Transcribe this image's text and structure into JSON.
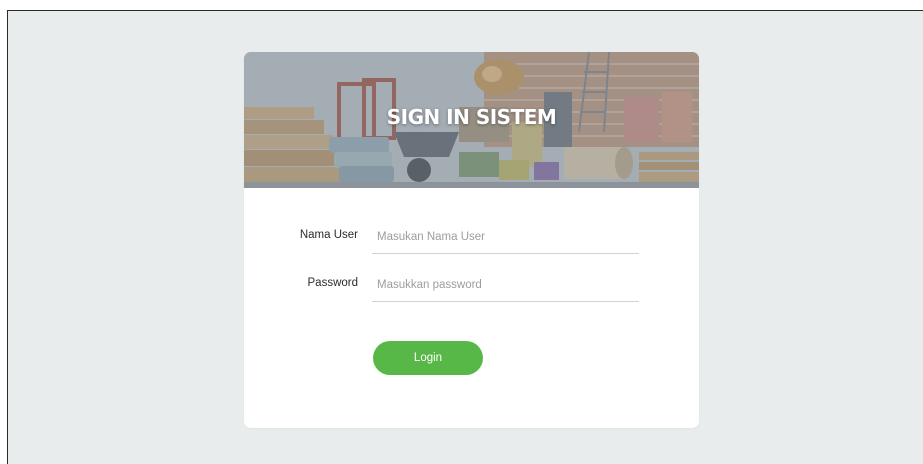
{
  "banner": {
    "title": "SIGN IN SISTEM",
    "image": "construction-materials-photo"
  },
  "form": {
    "username": {
      "label": "Nama User",
      "placeholder": "Masukan Nama User",
      "value": ""
    },
    "password": {
      "label": "Password",
      "placeholder": "Masukkan password",
      "value": ""
    },
    "login_label": "Login"
  },
  "colors": {
    "background": "#e9eced",
    "card": "#ffffff",
    "button": "#57b847",
    "banner_overlay": "#8e9aa4"
  }
}
